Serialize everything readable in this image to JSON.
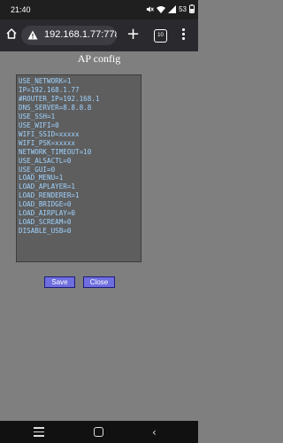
{
  "status_bar": {
    "time": "21:40",
    "battery": "53"
  },
  "browser": {
    "url": "192.168.1.77:7780",
    "tab_count": "10"
  },
  "page": {
    "title": "AP config",
    "config_text": "USE_NETWORK=1\nIP=192.168.1.77\n#ROUTER_IP=192.168.1\nDNS_SERVER=8.8.8.8\nUSE_SSH=1\nUSE_WIFI=0\nWIFI_SSID=xxxxx\nWIFI_PSK=xxxxx\nNETWORK_TIMEOUT=10\nUSE_ALSACTL=0\nUSE_GUI=0\nLOAD_MENU=1\nLOAD_APLAYER=1\nLOAD_RENDERER=1\nLOAD_BRIDGE=0\nLOAD_AIRPLAY=0\nLOAD_SCREAM=0\nDISABLE_USB=0",
    "save_label": "Save",
    "close_label": "Close"
  },
  "colors": {
    "page_bg": "#7f7f7f",
    "textarea_bg": "#5e5e5e",
    "textarea_text": "#9fd3ff",
    "button_bg": "#6e6edf"
  },
  "icons": {
    "status": [
      "mute-icon",
      "wifi-icon",
      "signal-icon",
      "battery-icon"
    ],
    "browser": [
      "home-icon",
      "insecure-warning-icon",
      "new-tab-icon",
      "tab-switcher-icon",
      "more-options-icon"
    ],
    "nav": [
      "recent-apps-icon",
      "home-button-icon",
      "back-icon"
    ]
  }
}
